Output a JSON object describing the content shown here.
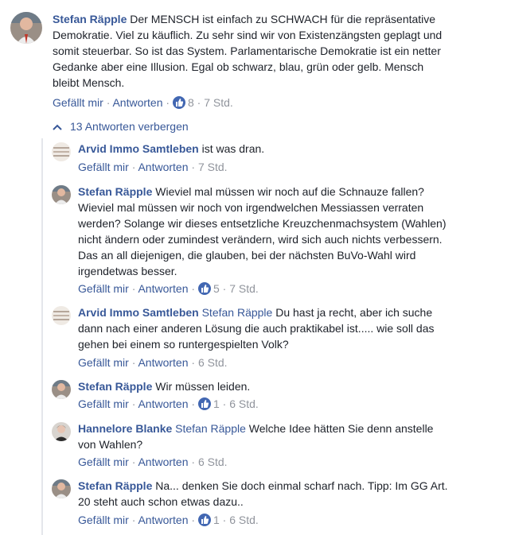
{
  "top_comment": {
    "author": "Stefan Räpple",
    "text": "Der MENSCH ist einfach zu SCHWACH für die repräsentative Demokratie. Viel zu käuflich. Zu sehr sind wir von Existenzängsten geplagt und somit steuerbar. So ist das System. Parlamentarische Demokratie ist ein netter Gedanke aber eine Illusion. Egal ob schwarz, blau, grün oder gelb. Mensch bleibt Mensch.",
    "like_label": "Gefällt mir",
    "reply_label": "Antworten",
    "likes": "8",
    "time": "7 Std."
  },
  "toggle_replies_label": "13 Antworten verbergen",
  "replies": [
    {
      "author": "Arvid Immo Samtleben",
      "mention": "",
      "text": "ist was dran.",
      "like_label": "Gefällt mir",
      "reply_label": "Antworten",
      "likes": "",
      "time": "7 Std."
    },
    {
      "author": "Stefan Räpple",
      "mention": "",
      "text": "Wieviel mal müssen wir noch auf die Schnauze fallen? Wieviel mal müssen wir noch von irgendwelchen Messiassen verraten werden? Solange wir dieses entsetzliche Kreuzchenmachsystem (Wahlen) nicht ändern oder zumindest verändern, wird sich auch nichts verbessern. Das an all diejenigen, die glauben, bei der nächsten BuVo-Wahl wird irgendetwas besser.",
      "like_label": "Gefällt mir",
      "reply_label": "Antworten",
      "likes": "5",
      "time": "7 Std."
    },
    {
      "author": "Arvid Immo Samtleben",
      "mention": "Stefan Räpple",
      "text": "Du hast ja recht, aber ich suche dann nach einer anderen Lösung die auch praktikabel ist..... wie soll das gehen bei einem so runtergespielten Volk?",
      "like_label": "Gefällt mir",
      "reply_label": "Antworten",
      "likes": "",
      "time": "6 Std."
    },
    {
      "author": "Stefan Räpple",
      "mention": "",
      "text": "Wir müssen leiden.",
      "like_label": "Gefällt mir",
      "reply_label": "Antworten",
      "likes": "1",
      "time": "6 Std."
    },
    {
      "author": "Hannelore Blanke",
      "mention": "Stefan Räpple",
      "text": "Welche Idee hätten Sie denn anstelle von Wahlen?",
      "like_label": "Gefällt mir",
      "reply_label": "Antworten",
      "likes": "",
      "time": "6 Std."
    },
    {
      "author": "Stefan Räpple",
      "mention": "",
      "text": "Na... denken Sie doch einmal scharf nach. Tipp: Im GG Art. 20 steht auch schon etwas dazu..",
      "like_label": "Gefällt mir",
      "reply_label": "Antworten",
      "likes": "1",
      "time": "6 Std."
    }
  ],
  "icons": {
    "like_badge": "thumbs-up-icon",
    "collapse": "chevron-up-icon"
  },
  "colors": {
    "link": "#385898",
    "meta_gray": "#90949c",
    "like_blue": "#4267b2",
    "text": "#1d2129"
  }
}
